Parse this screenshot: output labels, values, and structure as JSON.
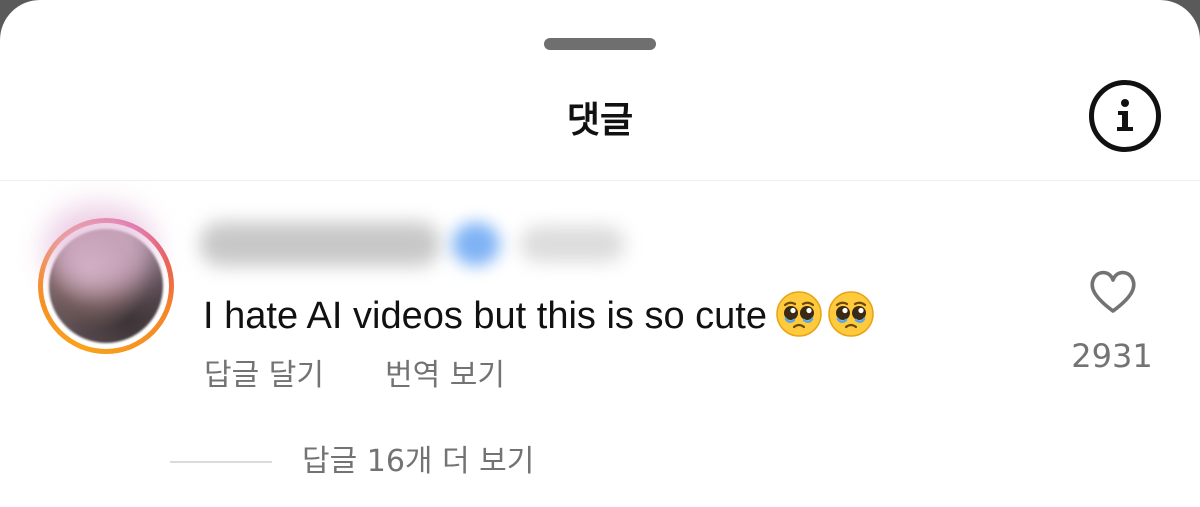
{
  "sheet": {
    "title": "댓글",
    "info_icon": "info-icon"
  },
  "comment": {
    "text": "I hate AI videos but this is so cute",
    "emojis": [
      "pleading-face-emoji",
      "pleading-face-emoji"
    ],
    "reply_label": "답글 달기",
    "translate_label": "번역 보기",
    "like_icon": "heart-outline-icon",
    "like_count": "2931",
    "view_replies_label": "답글 16개 더 보기"
  },
  "colors": {
    "text_primary": "#111111",
    "text_secondary": "#737373",
    "story_ring_start": "#f9a31a",
    "story_ring_end": "#dd2a7b"
  }
}
